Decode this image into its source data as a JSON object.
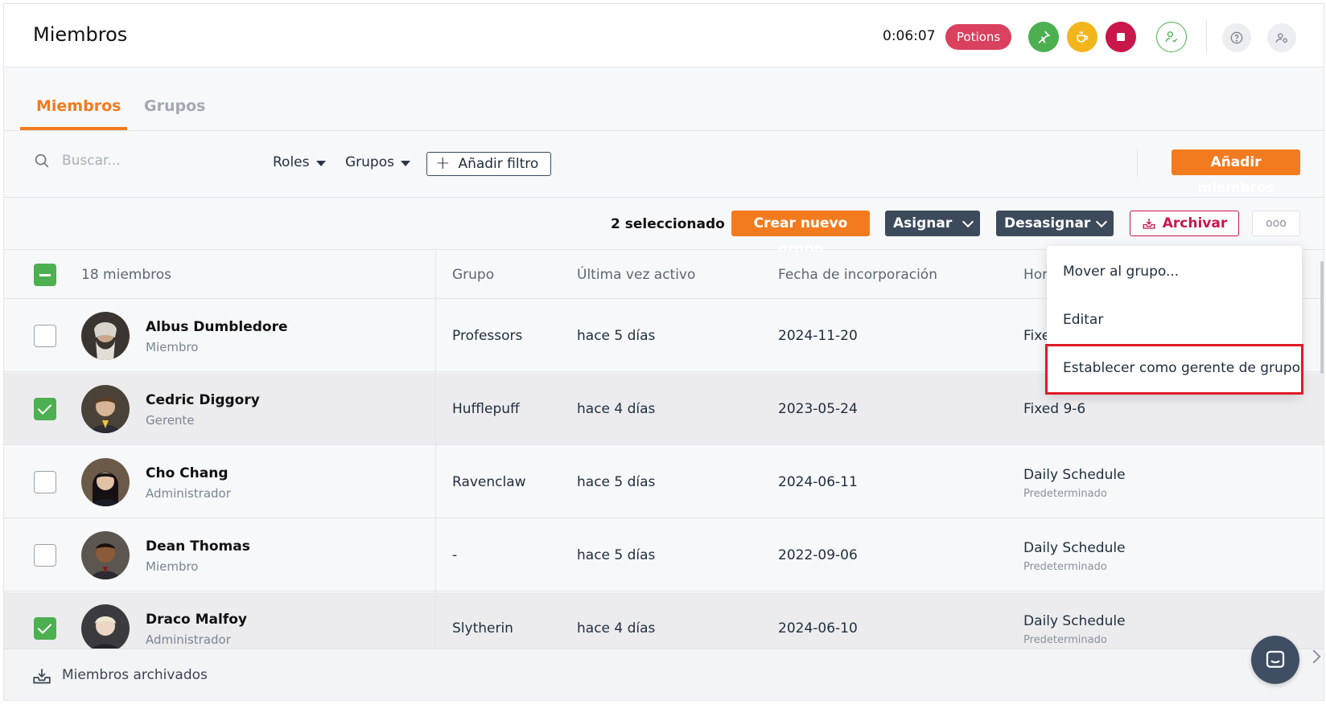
{
  "header": {
    "title": "Miembros",
    "timer": "0:06:07",
    "project_badge": "Potions"
  },
  "tabs": [
    {
      "label": "Miembros",
      "active": true
    },
    {
      "label": "Grupos",
      "active": false
    }
  ],
  "filters": {
    "search_placeholder": "Buscar...",
    "roles_label": "Roles",
    "groups_label": "Grupos",
    "add_filter_label": "Añadir filtro",
    "add_members_label": "Añadir miembros"
  },
  "actions": {
    "selected_text": "2 seleccionado",
    "create_group": "Crear nuevo grupo",
    "assign": "Asignar",
    "unassign": "Desasignar",
    "archive": "Archivar",
    "more": "ooo"
  },
  "dropdown_menu": {
    "items": [
      "Mover al grupo...",
      "Editar",
      "Establecer como gerente de grupo"
    ],
    "highlighted_index": 2
  },
  "table": {
    "headers": {
      "members": "18 miembros",
      "group": "Grupo",
      "last_active": "Última vez activo",
      "joined": "Fecha de incorporación",
      "schedule": "Hor"
    },
    "rows": [
      {
        "name": "Albus Dumbledore",
        "role": "Miembro",
        "group": "Professors",
        "last_active": "hace 5 días",
        "joined": "2024-11-20",
        "schedule": "Fixe",
        "schedule_sub": "",
        "selected": false
      },
      {
        "name": "Cedric Diggory",
        "role": "Gerente",
        "group": "Hufflepuff",
        "last_active": "hace 4 días",
        "joined": "2023-05-24",
        "schedule": "Fixed 9-6",
        "schedule_sub": "",
        "selected": true
      },
      {
        "name": "Cho Chang",
        "role": "Administrador",
        "group": "Ravenclaw",
        "last_active": "hace 5 días",
        "joined": "2024-06-11",
        "schedule": "Daily Schedule",
        "schedule_sub": "Predeterminado",
        "selected": false
      },
      {
        "name": "Dean Thomas",
        "role": "Miembro",
        "group": "-",
        "last_active": "hace 5 días",
        "joined": "2022-09-06",
        "schedule": "Daily Schedule",
        "schedule_sub": "Predeterminado",
        "selected": false
      },
      {
        "name": "Draco Malfoy",
        "role": "Administrador",
        "group": "Slytherin",
        "last_active": "hace 4 días",
        "joined": "2024-06-10",
        "schedule": "Daily Schedule",
        "schedule_sub": "Predeterminado",
        "selected": true
      }
    ]
  },
  "footer": {
    "archived_label": "Miembros archivados"
  },
  "colors": {
    "accent": "#f27b1f",
    "success": "#4caf50",
    "danger": "#c9164b",
    "dark_button": "#3d4a5c",
    "highlight": "#e01b24"
  },
  "icons": {
    "search": "search-icon",
    "timer_start": "pin-icon",
    "break": "coffee-icon",
    "stop": "stop-icon",
    "user": "user-check-icon",
    "help": "help-icon",
    "settings": "user-settings-icon",
    "archive": "archive-icon",
    "chat": "chat-icon"
  }
}
